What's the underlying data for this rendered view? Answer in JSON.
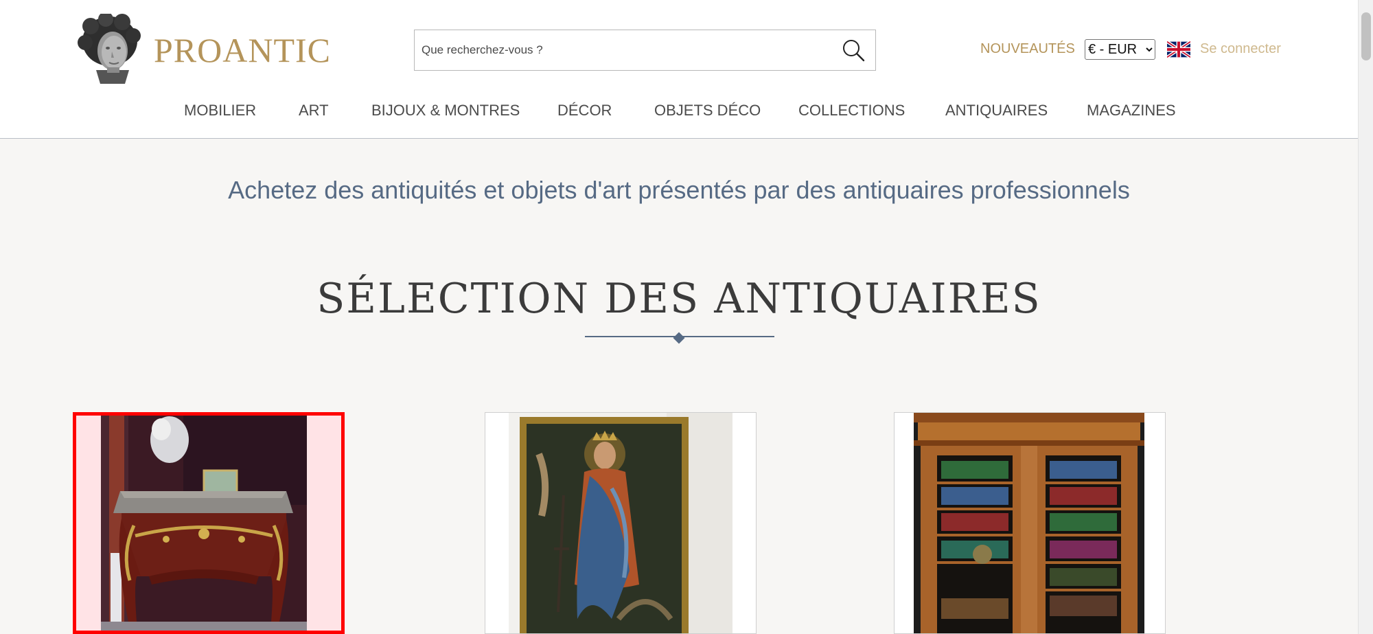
{
  "header": {
    "logo_text": "PROANTIC",
    "search_placeholder": "Que recherchez-vous ?",
    "nouveautes": "NOUVEAUTÉS",
    "currency_options": [
      "€ - EUR"
    ],
    "currency_selected": "€ - EUR",
    "login": "Se connecter"
  },
  "nav": {
    "items": [
      {
        "label": "MOBILIER"
      },
      {
        "label": "ART"
      },
      {
        "label": "BIJOUX & MONTRES"
      },
      {
        "label": "DÉCOR"
      },
      {
        "label": "OBJETS DÉCO"
      },
      {
        "label": "COLLECTIONS"
      },
      {
        "label": "ANTIQUAIRES"
      },
      {
        "label": "MAGAZINES"
      }
    ]
  },
  "main": {
    "tagline": "Achetez des antiquités et objets d'art présentés par des antiquaires professionnels",
    "section_title": "SÉLECTION DES ANTIQUAIRES"
  },
  "colors": {
    "gold": "#b4945a",
    "slate": "#566a84",
    "selection": "#ff0000"
  }
}
